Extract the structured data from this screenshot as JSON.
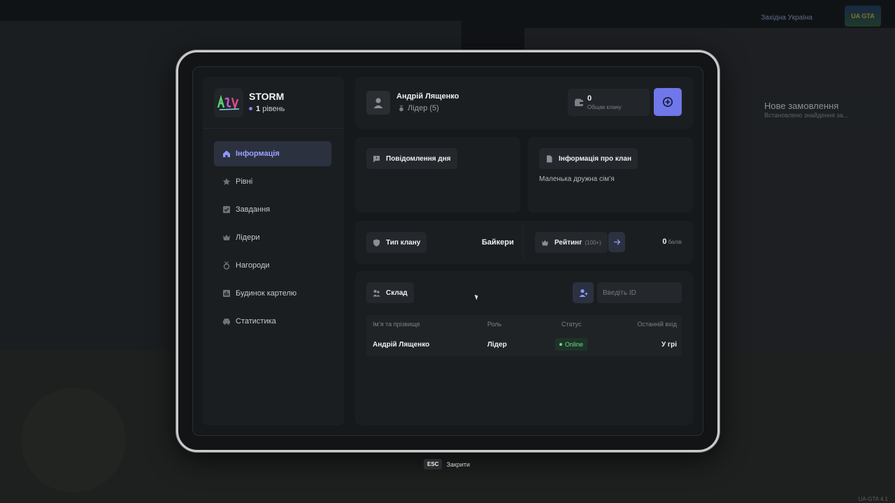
{
  "background": {
    "region": "Західна Україна",
    "logo_text": "UA GTA",
    "order_title": "Нове замовлення",
    "order_sub": "Встановлено знайдення за...",
    "version": "UA-GTA 4.1"
  },
  "clan": {
    "name": "STORM",
    "level_number": "1",
    "level_word": "рівень"
  },
  "nav": {
    "items": [
      {
        "label": "Інформація",
        "icon": "home-icon",
        "active": true
      },
      {
        "label": "Рівні",
        "icon": "star-icon"
      },
      {
        "label": "Завдання",
        "icon": "checkbox-icon"
      },
      {
        "label": "Лідери",
        "icon": "crown-icon"
      },
      {
        "label": "Нагороди",
        "icon": "medal-icon"
      },
      {
        "label": "Будинок картелю",
        "icon": "building-icon"
      },
      {
        "label": "Статистика",
        "icon": "car-icon"
      }
    ]
  },
  "user": {
    "name": "Андрій Лященко",
    "role": "Лідер (5)"
  },
  "bank": {
    "value": "0",
    "label": "Общак клану"
  },
  "motd": {
    "title": "Повідомлення дня"
  },
  "info": {
    "title": "Інформація про клан",
    "text": "Маленька дружна сім’я"
  },
  "type": {
    "title": "Тип клану",
    "value": "Байкери"
  },
  "rating": {
    "title": "Рейтинг",
    "hint": "(100+)",
    "score": "0",
    "unit": "балів"
  },
  "members": {
    "title": "Склад",
    "input_placeholder": "Введіть ID",
    "columns": [
      "Ім’я та прізвище",
      "Роль",
      "Статус",
      "Останній вхід"
    ],
    "rows": [
      {
        "name": "Андрій Лященко",
        "role": "Лідер",
        "status": "Online",
        "last": "У грі"
      }
    ]
  },
  "footer": {
    "key": "ESC",
    "label": "Закрити"
  },
  "colors": {
    "accent": "#7077ea",
    "online": "#6fdc8c",
    "panel": "#1b1e21"
  }
}
